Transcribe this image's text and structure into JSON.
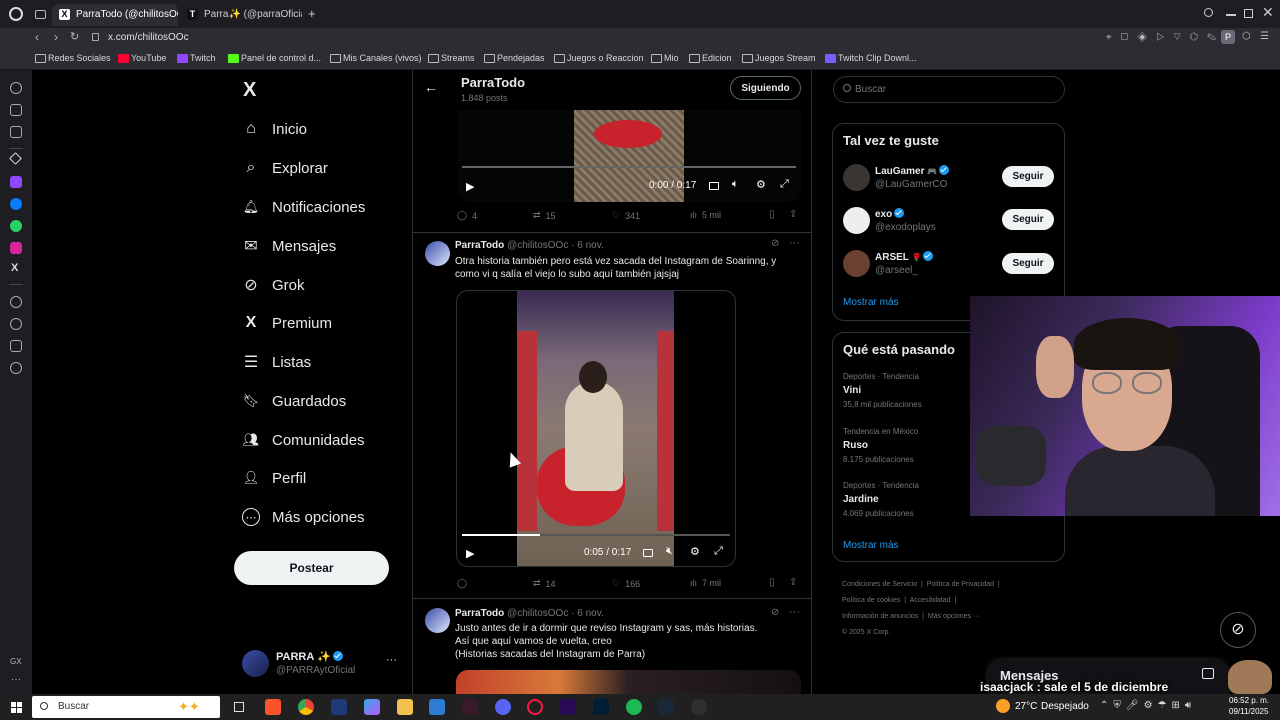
{
  "browser": {
    "tabs": [
      {
        "label": "ParraTodo (@chilitosOOc",
        "favicon": "X"
      },
      {
        "label": "Parra✨ (@parraOficial)",
        "favicon": "T"
      }
    ],
    "new_tab": "+",
    "url": "x.com/chilitosOOc",
    "profile_initial": "P",
    "bookmarks": [
      "Redes Sociales",
      "YouTube",
      "Twitch",
      "Panel de control d...",
      "Mis Canales (vivos)",
      "Streams",
      "Pendejadas",
      "Juegos o Reaccion",
      "Mio",
      "Edicion",
      "Juegos Stream",
      "Twitch Clip Downl..."
    ],
    "gx_label": "GX"
  },
  "nav": {
    "logo": "X",
    "items": [
      {
        "label": "Inicio",
        "icon": "home-icon",
        "glyph": "⌂"
      },
      {
        "label": "Explorar",
        "icon": "search-icon",
        "glyph": "⌕"
      },
      {
        "label": "Notificaciones",
        "icon": "bell-icon",
        "glyph": "🔔︎"
      },
      {
        "label": "Mensajes",
        "icon": "mail-icon",
        "glyph": "✉"
      },
      {
        "label": "Grok",
        "icon": "grok-icon",
        "glyph": "⊘"
      },
      {
        "label": "Premium",
        "icon": "x-premium-icon",
        "glyph": "X"
      },
      {
        "label": "Listas",
        "icon": "list-icon",
        "glyph": "☰"
      },
      {
        "label": "Guardados",
        "icon": "bookmark-icon",
        "glyph": "🔖︎"
      },
      {
        "label": "Comunidades",
        "icon": "people-icon",
        "glyph": "👥︎"
      },
      {
        "label": "Perfil",
        "icon": "person-icon",
        "glyph": "👤︎"
      },
      {
        "label": "Más opciones",
        "icon": "more-circle-icon",
        "glyph": "⋯"
      }
    ],
    "post_button": "Postear",
    "account": {
      "name": "PARRA ✨",
      "handle": "@PARRAytOficial",
      "menu": "···"
    }
  },
  "profile_header": {
    "name": "ParraTodo",
    "posts_count": "1.848 posts",
    "following_button": "Siguiendo"
  },
  "posts": [
    {
      "video_time": "0:00 / 0:17",
      "stats": {
        "replies": "4",
        "reposts": "15",
        "likes": "341",
        "views": "5 mil"
      }
    },
    {
      "author": "ParraTodo",
      "handle": "@chilitosOOc",
      "date": "· 6 nov.",
      "text": "Otra historia también pero está vez sacada del Instagram de Soarinng, y como vi q salía el viejo lo subo aquí también jajsjaj",
      "video_time": "0:05 / 0:17",
      "progress": 0.29,
      "stats": {
        "replies": "",
        "reposts": "14",
        "likes": "166",
        "views": "7 mil"
      }
    },
    {
      "author": "ParraTodo",
      "handle": "@chilitosOOc",
      "date": "· 6 nov.",
      "lines": [
        "Justo antes de ir a dormir que reviso Instagram y sas, más historias.",
        "Así que aquí vamos de vuelta, creo",
        "(Historias sacadas del Instagram de Parra)"
      ]
    }
  ],
  "sidebar": {
    "search_placeholder": "Buscar",
    "suggestions_title": "Tal vez te guste",
    "suggestions": [
      {
        "name": "LauGamer",
        "badge": "🎮",
        "handle": "@LauGamerCO",
        "button": "Seguir"
      },
      {
        "name": "exo",
        "badge": "",
        "handle": "@exodoplays",
        "button": "Seguir"
      },
      {
        "name": "ARSEL",
        "badge": "🌹",
        "handle": "@arseel_",
        "button": "Seguir"
      }
    ],
    "show_more": "Mostrar más",
    "trends_title": "Qué está pasando",
    "trends": [
      {
        "context": "Deportes · Tendencia",
        "name": "Vini",
        "count": "35,8 mil publicaciones"
      },
      {
        "context": "Tendencia en México",
        "name": "Ruso",
        "count": "8.175 publicaciones"
      },
      {
        "context": "Deportes · Tendencia",
        "name": "Jardine",
        "count": "4.069 publicaciones"
      }
    ],
    "trends_more": "Mostrar más",
    "footer": [
      "Condiciones de Servicio",
      "Política de Privacidad",
      "Política de cookies",
      "Accesibilidad",
      "Información de anuncios",
      "Más opciones ···",
      "© 2025 X Corp."
    ]
  },
  "overlay": {
    "messages_label": "Mensajes",
    "chat_line": "isaacjack : sale el 5 de diciembre"
  },
  "taskbar": {
    "search_placeholder": "Buscar",
    "temperature": "27°C",
    "weather": "Despejado",
    "time": "06:52 p. m.",
    "date": "09/11/2025"
  },
  "colors": {
    "accent": "#1d9bf0",
    "background": "#000000",
    "border": "#2f3336",
    "muted": "#71767b"
  }
}
